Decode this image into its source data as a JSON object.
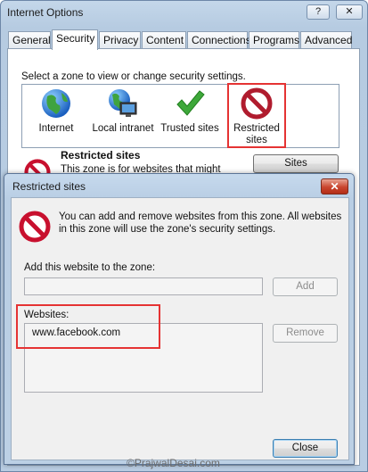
{
  "window": {
    "title": "Internet Options",
    "help_btn": "?",
    "close_btn": "✕"
  },
  "tabs": [
    {
      "label": "General"
    },
    {
      "label": "Security"
    },
    {
      "label": "Privacy"
    },
    {
      "label": "Content"
    },
    {
      "label": "Connections"
    },
    {
      "label": "Programs"
    },
    {
      "label": "Advanced"
    }
  ],
  "security": {
    "zone_prompt": "Select a zone to view or change security settings.",
    "zones": [
      {
        "label": "Internet",
        "icon": "globe-icon"
      },
      {
        "label": "Local intranet",
        "icon": "intranet-icon"
      },
      {
        "label": "Trusted sites",
        "icon": "checkmark-icon"
      },
      {
        "label_line1": "Restricted",
        "label_line2": "sites",
        "icon": "restricted-icon"
      }
    ],
    "selected_zone_title": "Restricted sites",
    "selected_zone_desc": "This zone is for websites that might",
    "sites_button": "Sites"
  },
  "dialog": {
    "title": "Restricted sites",
    "close_btn": "✕",
    "info_text": "You can add and remove websites from this zone. All websites in this zone will use the zone's security settings.",
    "add_label": "Add this website to the zone:",
    "add_input_value": "",
    "add_button": "Add",
    "websites_label": "Websites:",
    "websites": [
      "www.facebook.com"
    ],
    "remove_button": "Remove",
    "close_button": "Close"
  },
  "watermark": "©PrajwalDesai.com",
  "colors": {
    "highlight": "#e53333",
    "restricted_red": "#c8102e",
    "title_bar": "#b9cde3"
  }
}
